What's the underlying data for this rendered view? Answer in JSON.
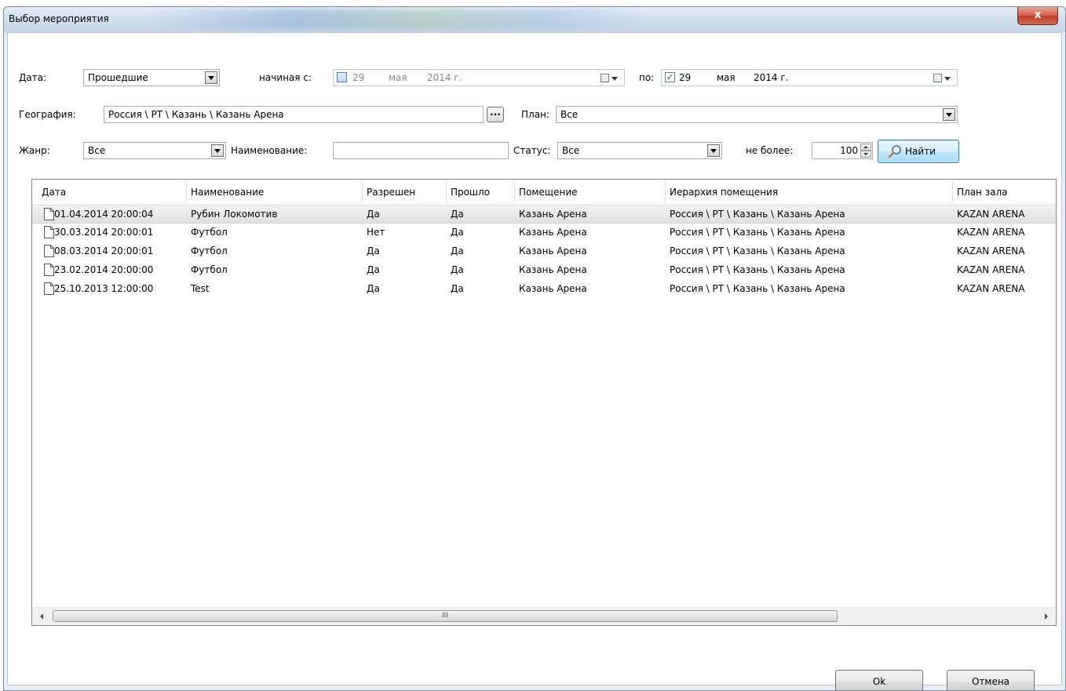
{
  "window": {
    "title": "Выбор мероприятия",
    "close_glyph": "x"
  },
  "filters": {
    "date_label": "Дата:",
    "date_mode": "Прошедшие",
    "from_label": "начиная с:",
    "from_checked": false,
    "from_day": "29",
    "from_month": "мая",
    "from_year": "2014 г.",
    "to_label": "по:",
    "to_checked": true,
    "to_day": "29",
    "to_month": "мая",
    "to_year": "2014 г.",
    "geo_label": "География:",
    "geo_value": "Россия \\ РТ \\ Казань \\ Казань Арена",
    "browse_label": "...",
    "plan_label": "План:",
    "plan_value": "Все",
    "genre_label": "Жанр:",
    "genre_value": "Все",
    "name_label": "Наименование:",
    "name_value": "",
    "status_label": "Статус:",
    "status_value": "Все",
    "limit_label": "не более:",
    "limit_value": "100",
    "find_label": "Найти"
  },
  "grid": {
    "columns": [
      "Дата",
      "Наименование",
      "Разрешен",
      "Прошло",
      "Помещение",
      "Иерархия помещения",
      "План зала"
    ],
    "rows": [
      [
        "01.04.2014 20:00:04",
        "Рубин Локомотив",
        "Да",
        "Да",
        "Казань Арена",
        "Россия \\ РТ \\ Казань \\ Казань Арена",
        "KAZAN ARENA"
      ],
      [
        "30.03.2014 20:00:01",
        "Футбол",
        "Нет",
        "Да",
        "Казань Арена",
        "Россия \\ РТ \\ Казань \\ Казань Арена",
        "KAZAN ARENA"
      ],
      [
        "08.03.2014 20:00:01",
        "Футбол",
        "Да",
        "Да",
        "Казань Арена",
        "Россия \\ РТ \\ Казань \\ Казань Арена",
        "KAZAN ARENA"
      ],
      [
        "23.02.2014 20:00:00",
        "Футбол",
        "Да",
        "Да",
        "Казань Арена",
        "Россия \\ РТ \\ Казань \\ Казань Арена",
        "KAZAN ARENA"
      ],
      [
        "25.10.2013 12:00:00",
        "Test",
        "Да",
        "Да",
        "Казань Арена",
        "Россия \\ РТ \\ Казань \\ Казань Арена",
        "KAZAN ARENA"
      ]
    ],
    "selected_row": 0,
    "scroll_thumb_label": "III"
  },
  "footer": {
    "ok_label": "Ok",
    "cancel_label": "Отмена"
  }
}
